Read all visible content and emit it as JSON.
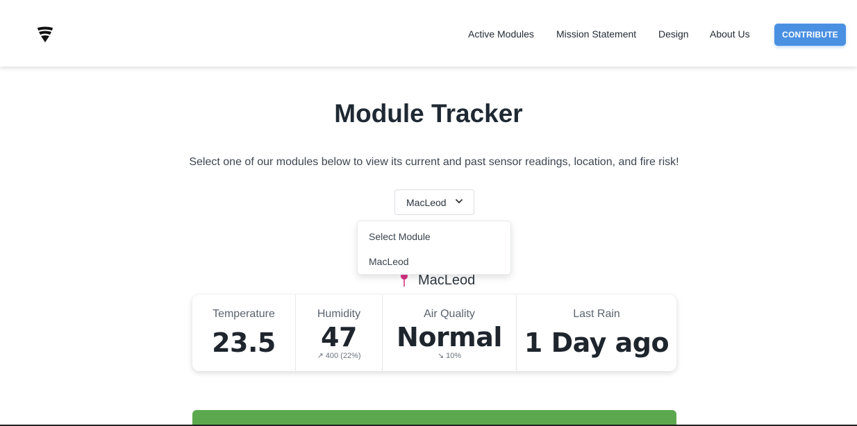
{
  "header": {
    "logo_icon": "flame-shield-logo",
    "nav": [
      {
        "label": "Active Modules"
      },
      {
        "label": "Mission Statement"
      },
      {
        "label": "Design"
      },
      {
        "label": "About Us"
      }
    ],
    "cta_label": "CONTRIBUTE"
  },
  "hero": {
    "title": "Module Tracker",
    "subtitle": "Select one of our modules below to view its current and past sensor readings, location, and fire risk!"
  },
  "module_select": {
    "selected": "MacLeod",
    "options": [
      {
        "label": "Select Module"
      },
      {
        "label": "MacLeod"
      }
    ]
  },
  "location": {
    "name": "MacLeod",
    "icon": "map-pin-icon"
  },
  "stats": [
    {
      "label": "Temperature",
      "value": "23.5",
      "help": ""
    },
    {
      "label": "Humidity",
      "value": "47",
      "help": "↗ 400 (22%)"
    },
    {
      "label": "Air Quality",
      "value": "Normal",
      "help": "↘ 10%"
    },
    {
      "label": "Last Rain",
      "value": "1 Day ago",
      "help": ""
    }
  ],
  "colors": {
    "accent": "#4a90e2",
    "pin": "#d63384",
    "risk_bar": "#5ca84e"
  }
}
